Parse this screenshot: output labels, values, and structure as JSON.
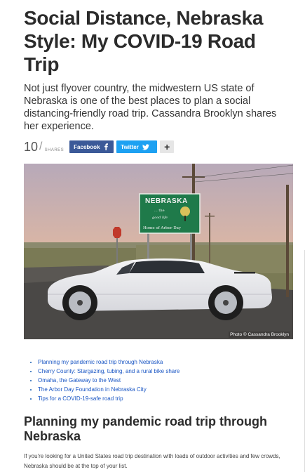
{
  "article": {
    "title": "Social Distance, Nebraska Style: My COVID-19 Road Trip",
    "dek": "Not just flyover country, the midwestern US state of Nebraska is one of the best places to plan a social distancing-friendly road trip. Cassandra Brooklyn shares her experience."
  },
  "share": {
    "count": "10",
    "slash": "/",
    "label": "shares",
    "facebook_label": "Facebook",
    "twitter_label": "Twitter",
    "more_label": "+"
  },
  "hero": {
    "sign_title": "NEBRASKA",
    "sign_line1": "... the",
    "sign_line2": "good life",
    "sign_line3": "Home of Arbor Day",
    "credit": "Photo © Cassandra Brooklyn"
  },
  "toc": {
    "items": [
      "Planning my pandemic road trip through Nebraska",
      "Cherry County: Stargazing, tubing, and a rural bike share",
      "Omaha, the Gateway to the West",
      "The Arbor Day Foundation in Nebraska City",
      "Tips for a COVID-19-safe road trip"
    ]
  },
  "section": {
    "heading": "Planning my pandemic road trip through Nebraska",
    "body": "If you're looking for a United States road trip destination with loads of outdoor activities and few crowds, Nebraska should be at the top of your list."
  },
  "icons": {
    "facebook": "facebook-icon",
    "twitter": "twitter-icon",
    "more": "plus-icon"
  },
  "colors": {
    "facebook": "#3b5998",
    "twitter": "#1da1f2",
    "link": "#1a56c4",
    "sign_green": "#1f7a4a"
  }
}
